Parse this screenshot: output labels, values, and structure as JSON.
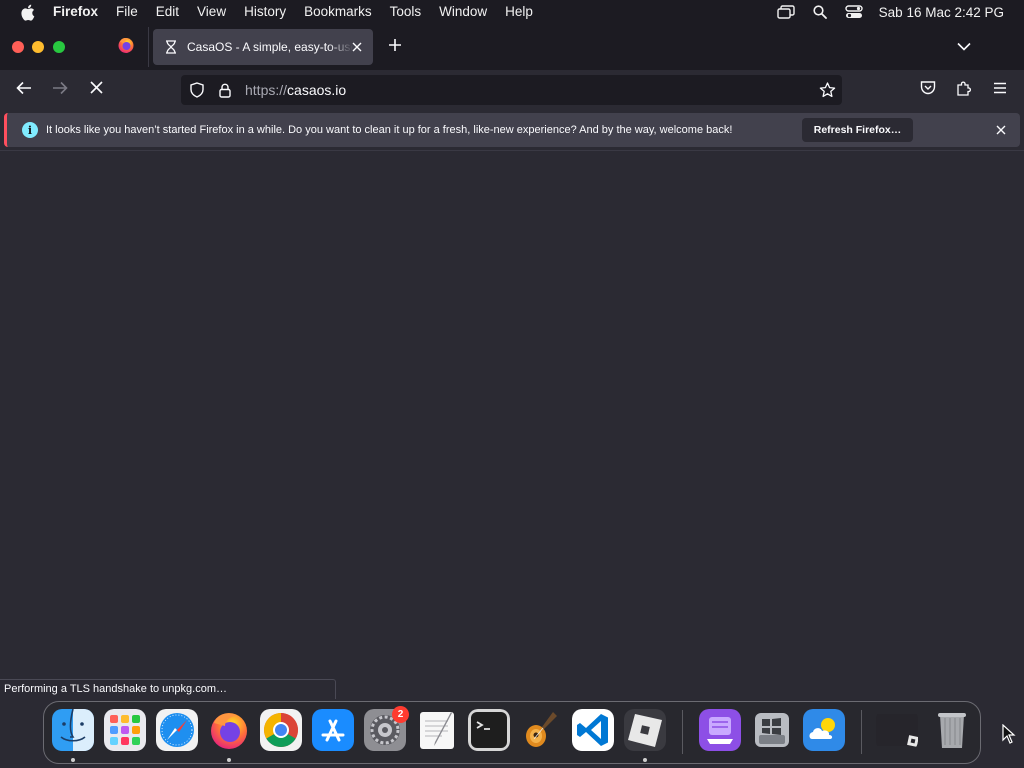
{
  "menubar": {
    "apple_icon": "apple-logo",
    "app_name": "Firefox",
    "items": [
      "File",
      "Edit",
      "View",
      "History",
      "Bookmarks",
      "Tools",
      "Window",
      "Help"
    ],
    "status_icons": [
      "screen-mirroring-icon",
      "spotlight-search-icon",
      "control-center-icon"
    ],
    "clock": "Sab 16 Mac  2:42 PG"
  },
  "tabs": {
    "pinned_icon": "firefox-icon",
    "active_title": "CasaOS - A simple, easy-to-use",
    "active_favicon": "hourglass-loading-icon"
  },
  "navbar": {
    "url_scheme": "https://",
    "url_host": "casaos.io"
  },
  "notification": {
    "message": "It looks like you haven’t started Firefox in a while. Do you want to clean it up for a fresh, like-new experience? And by the way, welcome back!",
    "action_label": "Refresh Firefox…",
    "info_glyph": "i",
    "accent_color": "#ff4f5e"
  },
  "status": {
    "text": "Performing a TLS handshake to unpkg.com…"
  },
  "dock": {
    "apps": [
      "Finder",
      "Launchpad",
      "Safari",
      "Firefox",
      "Google Chrome",
      "App Store",
      "System Settings",
      "TextEdit",
      "Terminal",
      "GarageBand",
      "Visual Studio Code",
      "Roblox",
      "Apple Configurator",
      "Boot Camp Assistant",
      "Weather",
      "Roblox Window",
      "Trash"
    ],
    "settings_badge": "2"
  },
  "colors": {
    "menubar_bg": "#1c1b22",
    "toolbar_bg": "#2b2a33",
    "tab_active_bg": "#42414d",
    "info_icon": "#80ebff"
  }
}
